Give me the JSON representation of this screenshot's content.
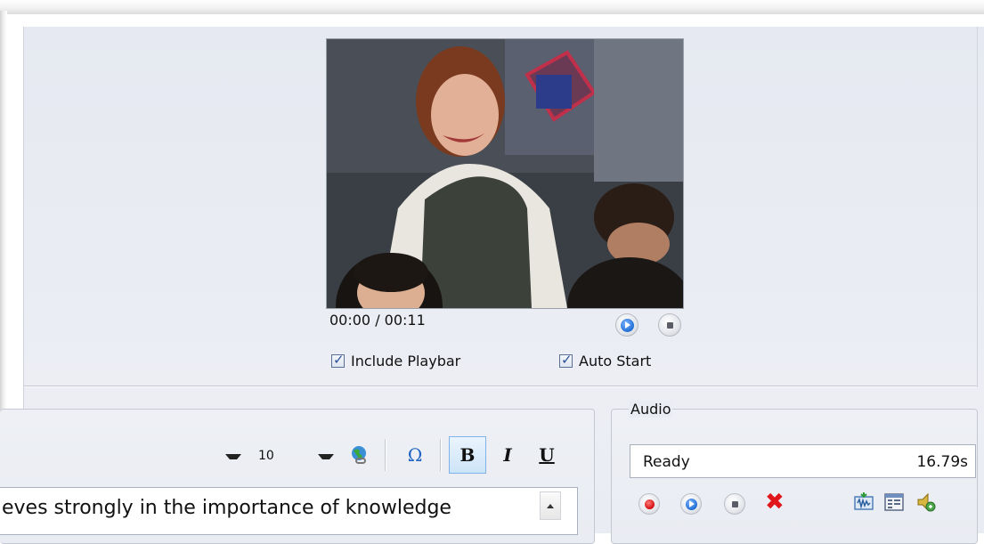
{
  "video": {
    "time_display": "00:00 / 00:11",
    "play_icon": "play-icon",
    "stop_icon": "stop-icon"
  },
  "options": {
    "include_playbar": {
      "label": "Include Playbar",
      "checked": true
    },
    "auto_start": {
      "label": "Auto Start",
      "checked": true
    }
  },
  "editor": {
    "font_size": "10",
    "buttons": {
      "bold": "B",
      "italic": "I",
      "underline": "U",
      "symbol": "Ω"
    },
    "text": "eves strongly in the importance of knowledge"
  },
  "audio": {
    "legend": "Audio",
    "status": "Ready",
    "duration": "16.79s"
  },
  "colors": {
    "panel_bg": "#e9ecf2",
    "record_red": "#d40d0d",
    "delete_red": "#e0161b",
    "play_blue": "#1f6ed6",
    "active_button": "#cde4f8"
  }
}
